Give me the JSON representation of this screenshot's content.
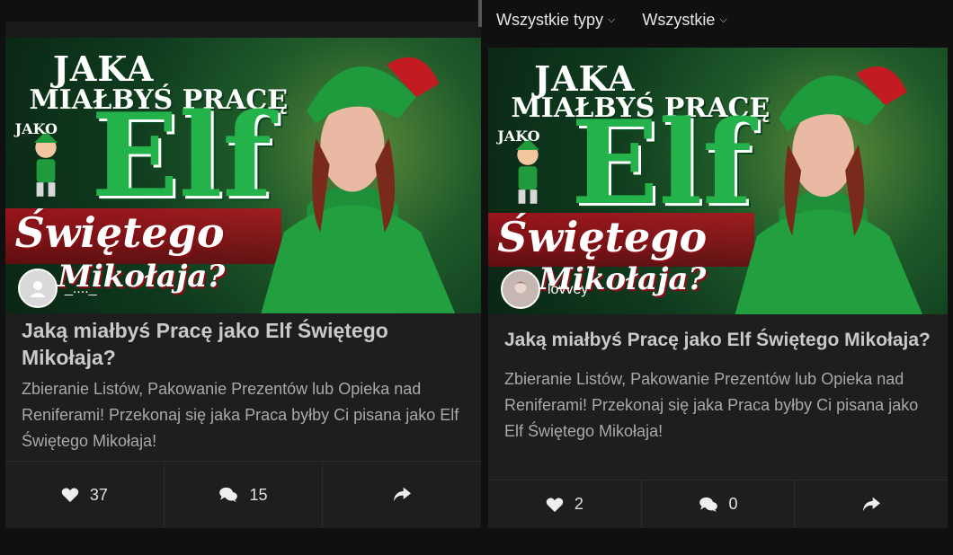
{
  "filters": {
    "types_label": "Wszystkie typy",
    "all_label": "Wszystkie"
  },
  "cards": [
    {
      "thumbnail": {
        "line1": "JAKA",
        "line2": "MIAŁBYŚ PRACĘ",
        "line3": "JAKO",
        "line4": "Elf",
        "line5": "Świętego",
        "line6": "Mikołaja?"
      },
      "username": "_...._",
      "title": "Jaką miałbyś Pracę jako Elf Świętego Mikołaja?",
      "description": "Zbieranie Listów, Pakowanie Prezentów lub Opieka nad Reniferami! Przekonaj się jaka Praca byłby Ci pisana jako Elf Świętego Mikołaja!",
      "likes": "37",
      "comments": "15"
    },
    {
      "thumbnail": {
        "line1": "JAKA",
        "line2": "MIAŁBYŚ PRACĘ",
        "line3": "JAKO",
        "line4": "Elf",
        "line5": "Świętego",
        "line6": "Mikołaja?"
      },
      "username": "lovvey",
      "title": "Jaką miałbyś Pracę jako Elf Świętego Mikołaja?",
      "description": "Zbieranie Listów, Pakowanie Prezentów lub Opieka nad Reniferami! Przekonaj się jaka Praca byłby Ci pisana jako Elf Świętego Mikołaja!",
      "likes": "2",
      "comments": "0"
    }
  ],
  "icons": {
    "like": "heart-icon",
    "comment": "comments-icon",
    "share": "share-icon",
    "dropdown": "chevron-down-icon"
  },
  "colors": {
    "background": "#101010",
    "card": "#1e1e1e",
    "elf_green": "#23b34a"
  }
}
